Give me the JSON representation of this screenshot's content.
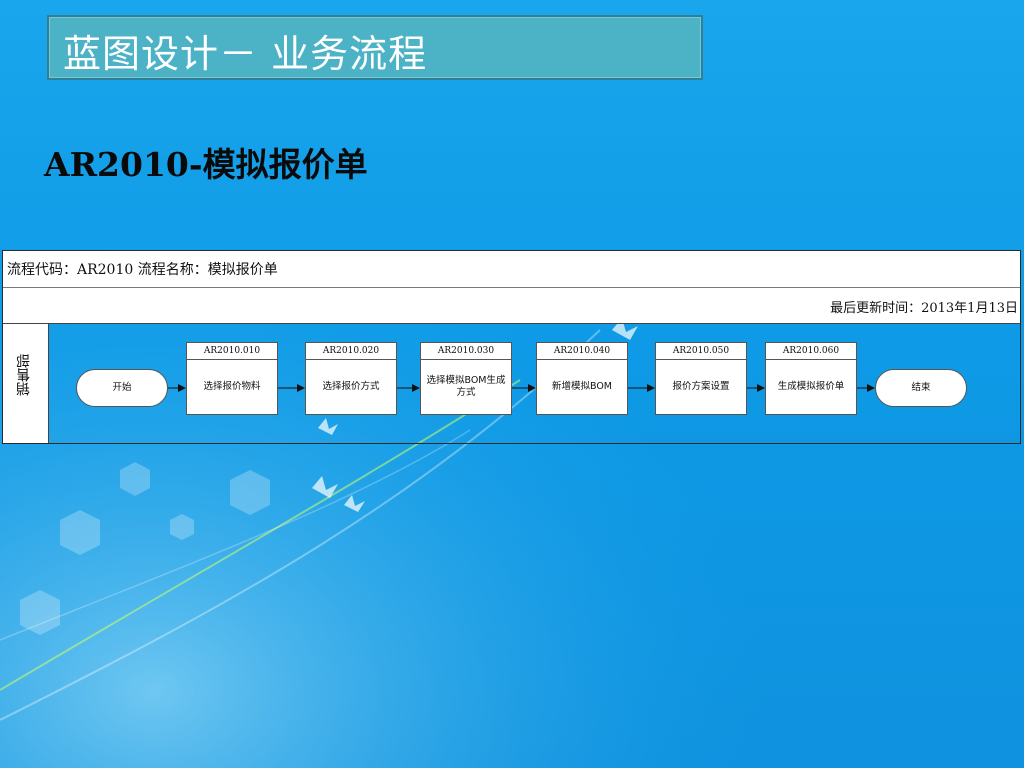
{
  "title": "蓝图设计－ 业务流程",
  "subtitle": "AR2010-模拟报价单",
  "process": {
    "code_line": "流程代码：AR2010 流程名称：模拟报价单",
    "updated_line": "最后更新时间：2013年1月13日",
    "lane": "销售部",
    "start": "开始",
    "end": "结束",
    "steps": [
      {
        "code": "AR2010.010",
        "label": "选择报价物料"
      },
      {
        "code": "AR2010.020",
        "label": "选择报价方式"
      },
      {
        "code": "AR2010.030",
        "label": "选择模拟BOM生成方式"
      },
      {
        "code": "AR2010.040",
        "label": "新增模拟BOM"
      },
      {
        "code": "AR2010.050",
        "label": "报价方案设置"
      },
      {
        "code": "AR2010.060",
        "label": "生成模拟报价单"
      }
    ]
  },
  "colors": {
    "background": "#0f9be6",
    "title_box": "#4cb2c6",
    "node_fill": "#ffffff",
    "node_border": "#555555"
  }
}
